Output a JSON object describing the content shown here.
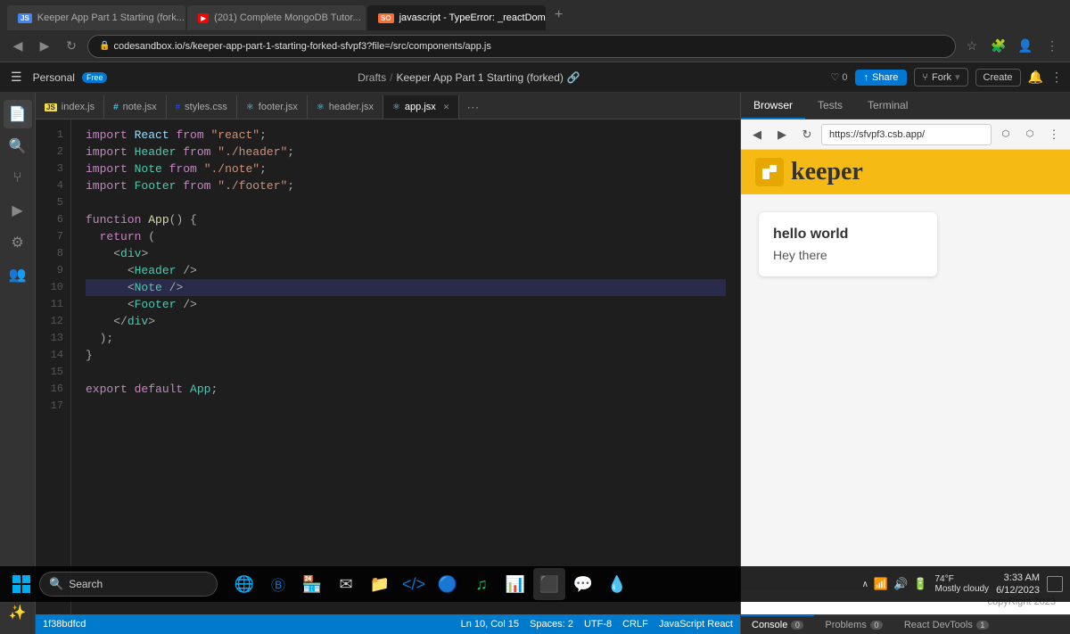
{
  "browser": {
    "tabs": [
      {
        "label": "Keeper App Part 1 Starting (fork...",
        "favicon_color": "#4285f4",
        "favicon_text": "JS",
        "active": false
      },
      {
        "label": "(201) Complete MongoDB Tutor...",
        "favicon_color": "#ff0000",
        "favicon_text": "▶",
        "active": false
      },
      {
        "label": "javascript - TypeError: _reactDom...",
        "favicon_color": "#ff6b35",
        "favicon_text": "SO",
        "active": true
      }
    ],
    "url": "codesandbox.io/s/keeper-app-part-1-starting-forked-sfvpf3?file=/src/components/app.js"
  },
  "topbar": {
    "workspace": "Personal",
    "free_badge": "Free",
    "path": "Drafts",
    "project": "Keeper App Part 1 Starting (forked)",
    "heart": "0",
    "share_label": "Share",
    "fork_label": "Fork",
    "create_label": "Create"
  },
  "file_tabs": [
    {
      "name": "index.js",
      "color": "#f0db4f",
      "prefix": "JS"
    },
    {
      "name": "note.jsx",
      "color": "#61dafb",
      "prefix": "RE"
    },
    {
      "name": "styles.css",
      "color": "#264de4",
      "prefix": "CSS"
    },
    {
      "name": "footer.jsx",
      "color": "#61dafb",
      "prefix": "RE"
    },
    {
      "name": "header.jsx",
      "color": "#61dafb",
      "prefix": "RE"
    },
    {
      "name": "app.jsx",
      "color": "#61dafb",
      "prefix": "RE",
      "active": true
    }
  ],
  "code_lines": [
    {
      "num": 1,
      "content": "import React from \"react\";"
    },
    {
      "num": 2,
      "content": "import Header from \"./header\";"
    },
    {
      "num": 3,
      "content": "import Note from \"./note\";"
    },
    {
      "num": 4,
      "content": "import Footer from \"./footer\";"
    },
    {
      "num": 5,
      "content": ""
    },
    {
      "num": 6,
      "content": "function App() {"
    },
    {
      "num": 7,
      "content": "  return ("
    },
    {
      "num": 8,
      "content": "    <div>"
    },
    {
      "num": 9,
      "content": "      <Header />"
    },
    {
      "num": 10,
      "content": "      <Note />",
      "highlighted": true
    },
    {
      "num": 11,
      "content": "      <Footer />"
    },
    {
      "num": 12,
      "content": "    </div>"
    },
    {
      "num": 13,
      "content": "  );"
    },
    {
      "num": 14,
      "content": "}"
    },
    {
      "num": 15,
      "content": ""
    },
    {
      "num": 16,
      "content": "export default App;"
    },
    {
      "num": 17,
      "content": ""
    }
  ],
  "status_bar": {
    "git": "1f38bdfcd",
    "position": "Ln 10, Col 15",
    "spaces": "Spaces: 2",
    "encoding": "UTF-8",
    "line_ending": "CRLF",
    "language": "JavaScript React"
  },
  "browser_panel": {
    "tabs": [
      "Browser",
      "Tests",
      "Terminal"
    ],
    "active_tab": "Browser",
    "url": "https://sfvpf3.csb.app/",
    "bottom_tabs": [
      {
        "label": "Console",
        "count": "0"
      },
      {
        "label": "Problems",
        "count": "0"
      },
      {
        "label": "React DevTools",
        "count": "1"
      }
    ]
  },
  "keeper_app": {
    "title": "keeper",
    "note": {
      "title": "hello world",
      "body": "Hey there"
    },
    "footer": "copyRight 2023"
  },
  "taskbar": {
    "search_placeholder": "Search",
    "time": "3:33 AM",
    "date": "6/12/2023",
    "temp": "74°F",
    "weather": "Mostly cloudy"
  }
}
